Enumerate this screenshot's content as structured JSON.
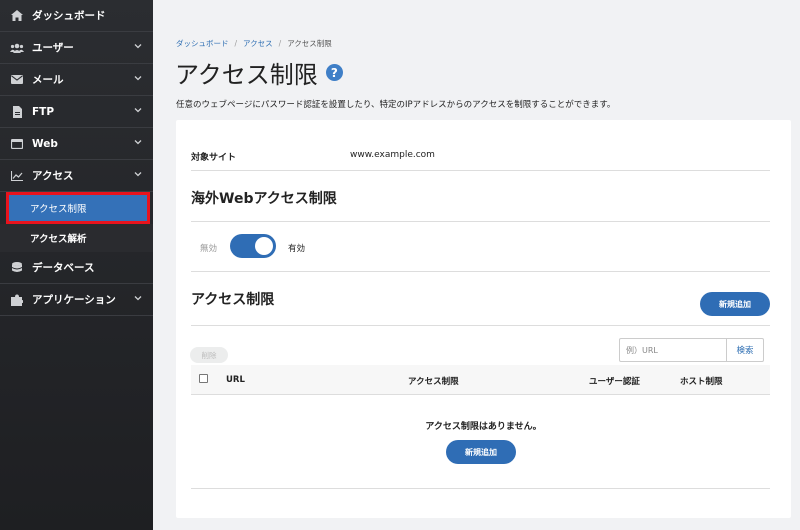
{
  "sidebar": {
    "items": [
      {
        "label": "ダッシュボード",
        "icon": "home-icon"
      },
      {
        "label": "ユーザー",
        "icon": "users-icon"
      },
      {
        "label": "メール",
        "icon": "mail-icon"
      },
      {
        "label": "FTP",
        "icon": "file-icon"
      },
      {
        "label": "Web",
        "icon": "window-icon"
      },
      {
        "label": "アクセス",
        "icon": "chart-icon"
      },
      {
        "label": "データベース",
        "icon": "database-icon"
      },
      {
        "label": "アプリケーション",
        "icon": "puzzle-icon"
      }
    ],
    "sub_active": "アクセス制限",
    "sub_other": "アクセス解析"
  },
  "breadcrumb": {
    "home": "ダッシュボード",
    "parent": "アクセス",
    "current": "アクセス制限",
    "sep": "/"
  },
  "page": {
    "title": "アクセス制限",
    "help": "?",
    "description": "任意のウェブページにパスワード認証を設置したり、特定のIPアドレスからのアクセスを制限することができます。"
  },
  "site": {
    "label": "対象サイト",
    "value": "www.example.com"
  },
  "overseas": {
    "title": "海外Webアクセス制限",
    "off_label": "無効",
    "on_label": "有効",
    "enabled": true
  },
  "access": {
    "title": "アクセス制限",
    "add_label": "新規追加",
    "delete_label": "削除",
    "search_placeholder": "例）URL",
    "search_label": "検索",
    "columns": [
      "URL",
      "アクセス制限",
      "ユーザー認証",
      "ホスト制限"
    ],
    "empty_message": "アクセス制限はありません。",
    "empty_add_label": "新規追加"
  },
  "colors": {
    "accent": "#2f6db5",
    "highlight": "#e8131d",
    "sidebar_bg": "#2b2d31"
  }
}
